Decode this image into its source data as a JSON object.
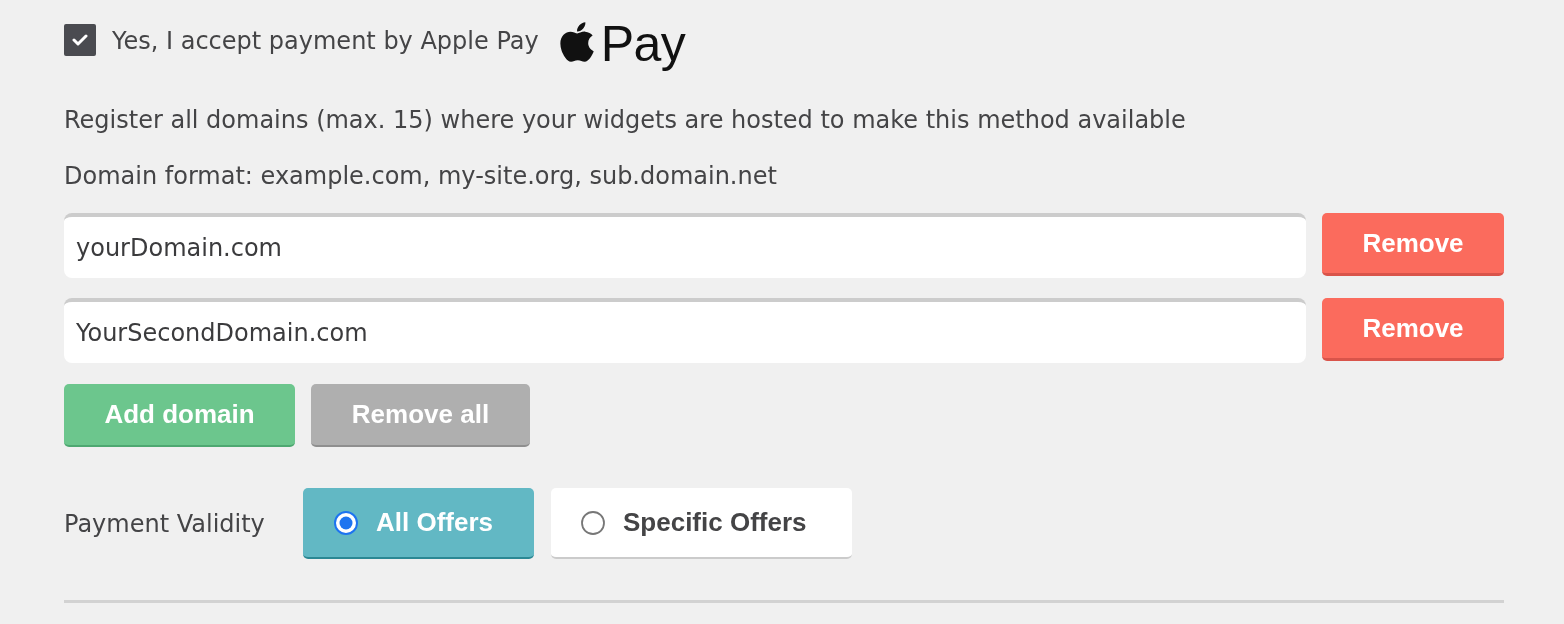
{
  "apple_pay": {
    "checked": true,
    "label": "Yes, I accept payment by Apple Pay",
    "logo_text": "Pay"
  },
  "instructions": [
    "Register all domains (max. 15) where your widgets are hosted to make this method available",
    "Domain format: example.com, my-site.org, sub.domain.net"
  ],
  "domains": [
    {
      "value": "yourDomain.com",
      "remove_label": "Remove"
    },
    {
      "value": "YourSecondDomain.com",
      "remove_label": "Remove"
    }
  ],
  "actions": [
    {
      "kind": "add",
      "label": "Add domain"
    },
    {
      "kind": "remove_all",
      "label": "Remove all"
    }
  ],
  "payment_validity": {
    "label": "Payment Validity",
    "options": [
      {
        "label": "All Offers",
        "selected": true
      },
      {
        "label": "Specific Offers",
        "selected": false
      }
    ]
  }
}
